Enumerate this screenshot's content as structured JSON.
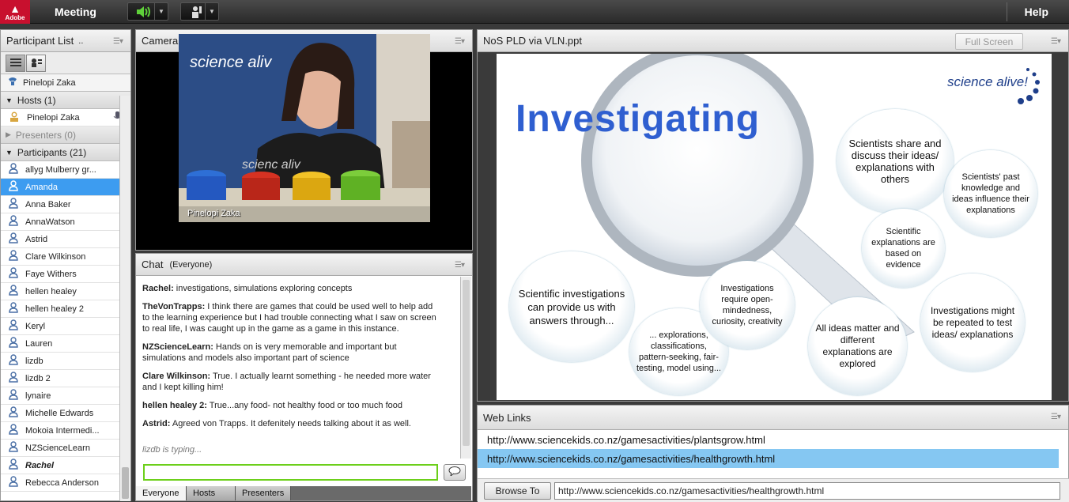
{
  "topbar": {
    "logo_text": "Adobe",
    "menu_meeting": "Meeting",
    "help": "Help"
  },
  "participants_pod": {
    "title": "Participant List",
    "title_suffix": "..",
    "me": "Pinelopi Zaka",
    "hosts_label": "Hosts (1)",
    "host_name": "Pinelopi Zaka",
    "presenters_label": "Presenters (0)",
    "participants_label": "Participants (21)",
    "participants": [
      {
        "name": "allyg Mulberry gr...",
        "selected": false,
        "italic": false
      },
      {
        "name": "Amanda",
        "selected": true,
        "italic": false
      },
      {
        "name": "Anna Baker",
        "selected": false,
        "italic": false
      },
      {
        "name": "AnnaWatson",
        "selected": false,
        "italic": false
      },
      {
        "name": "Astrid",
        "selected": false,
        "italic": false
      },
      {
        "name": "Clare Wilkinson",
        "selected": false,
        "italic": false
      },
      {
        "name": "Faye Withers",
        "selected": false,
        "italic": false
      },
      {
        "name": "hellen healey",
        "selected": false,
        "italic": false
      },
      {
        "name": "hellen healey 2",
        "selected": false,
        "italic": false
      },
      {
        "name": "Keryl",
        "selected": false,
        "italic": false
      },
      {
        "name": "Lauren",
        "selected": false,
        "italic": false
      },
      {
        "name": "lizdb",
        "selected": false,
        "italic": false
      },
      {
        "name": "lizdb 2",
        "selected": false,
        "italic": false
      },
      {
        "name": "lynaire",
        "selected": false,
        "italic": false
      },
      {
        "name": "Michelle Edwards",
        "selected": false,
        "italic": false
      },
      {
        "name": "Mokoia Intermedi...",
        "selected": false,
        "italic": false
      },
      {
        "name": "NZScienceLearn",
        "selected": false,
        "italic": false
      },
      {
        "name": "Rachel",
        "selected": false,
        "italic": true
      },
      {
        "name": "Rebecca Anderson",
        "selected": false,
        "italic": false
      }
    ]
  },
  "camera_pod": {
    "title": "Camera and Voice",
    "video_caption": "Pinelopi Zaka",
    "backdrop_text": "science aliv",
    "shirt_text": "scienc aliv"
  },
  "chat_pod": {
    "title": "Chat",
    "scope": "(Everyone)",
    "messages": [
      {
        "sender": "Rachel:",
        "text": " investigations, simulations exploring concepts"
      },
      {
        "sender": "TheVonTrapps:",
        "text": " I think there are games that could be used well to help add to the learning experience but I had trouble connecting what I saw on screen to real life, I was caught up in the game as a game in this instance."
      },
      {
        "sender": "NZScienceLearn:",
        "text": " Hands on is very memorable and important but simulations and models also important part of science"
      },
      {
        "sender": "Clare Wilkinson:",
        "text": " True. I actually learnt something - he needed more water and I kept killing him!"
      },
      {
        "sender": "hellen healey 2:",
        "text": " True...any food-  not healthy food or too much food"
      },
      {
        "sender": "Astrid:",
        "text": " Agreed von Trapps. It defenitely needs talking about it as well."
      }
    ],
    "typing": "lizdb is typing...",
    "input_value": "",
    "tabs": [
      "Everyone",
      "Hosts",
      "Presenters"
    ]
  },
  "share_pod": {
    "title": "NoS PLD via VLN.ppt",
    "fullscreen": "Full Screen",
    "slide": {
      "heading": "Investigating",
      "brand": "science alive!",
      "bubbles": [
        "Scientists share and discuss their ideas/ explanations with others",
        "Scientists' past knowledge and ideas influence their explanations",
        "Scientific explanations are based on evidence",
        "Scientific investigations can provide us with answers through...",
        "... explorations, classifications, pattern-seeking, fair-testing, model using...",
        "Investigations require open-mindedness, curiosity, creativity",
        "All ideas matter and different explanations are explored",
        "Investigations might be repeated to test ideas/ explanations"
      ]
    }
  },
  "weblinks_pod": {
    "title": "Web Links",
    "links": [
      {
        "url": "http://www.sciencekids.co.nz/gamesactivities/plantsgrow.html",
        "selected": false
      },
      {
        "url": "http://www.sciencekids.co.nz/gamesactivities/healthgrowth.html",
        "selected": true
      }
    ],
    "browse_label": "Browse To",
    "browse_url": "http://www.sciencekids.co.nz/gamesactivities/healthgrowth.html"
  },
  "colors": {
    "selection_blue": "#3d9cf0",
    "link_selection": "#85c7f2",
    "chat_input_border": "#6ccf1a",
    "slide_heading": "#2f5fd0",
    "adobe_red": "#c8102e"
  }
}
